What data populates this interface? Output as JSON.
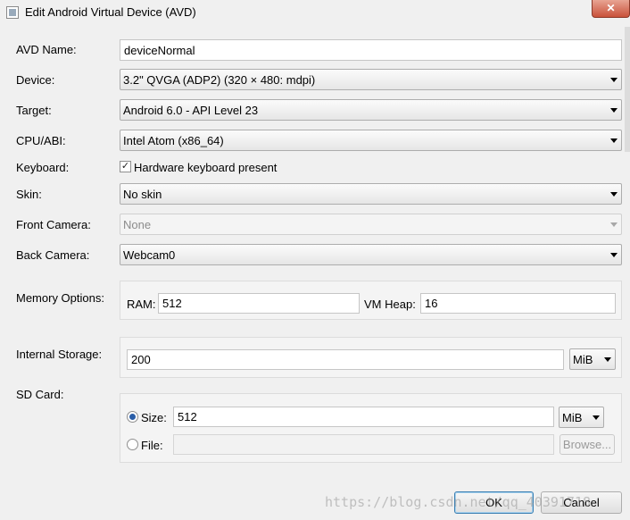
{
  "window": {
    "title": "Edit Android Virtual Device (AVD)",
    "close_label": "✕"
  },
  "form": {
    "avd_name": {
      "label": "AVD Name:",
      "value": "deviceNormal"
    },
    "device": {
      "label": "Device:",
      "value": "3.2\" QVGA (ADP2) (320 × 480: mdpi)"
    },
    "target": {
      "label": "Target:",
      "value": "Android 6.0 - API Level 23"
    },
    "cpu_abi": {
      "label": "CPU/ABI:",
      "value": "Intel Atom (x86_64)"
    },
    "keyboard": {
      "label": "Keyboard:",
      "checkbox_label": "Hardware keyboard present",
      "checked": true,
      "check_mark": "✓"
    },
    "skin": {
      "label": "Skin:",
      "value": "No skin"
    },
    "front_camera": {
      "label": "Front Camera:",
      "value": "None"
    },
    "back_camera": {
      "label": "Back Camera:",
      "value": "Webcam0"
    },
    "memory": {
      "label": "Memory Options:",
      "ram_label": "RAM:",
      "ram_value": "512",
      "vm_heap_label": "VM Heap:",
      "vm_heap_value": "16"
    },
    "internal_storage": {
      "label": "Internal Storage:",
      "value": "200",
      "unit": "MiB"
    },
    "sd_card": {
      "label": "SD Card:",
      "size_label": "Size:",
      "size_value": "512",
      "size_unit": "MiB",
      "size_selected": true,
      "file_label": "File:",
      "file_value": "",
      "browse_label": "Browse..."
    }
  },
  "buttons": {
    "ok": "OK",
    "cancel": "Cancel"
  },
  "watermark": "https://blog.csdn.net/qq_40391718"
}
